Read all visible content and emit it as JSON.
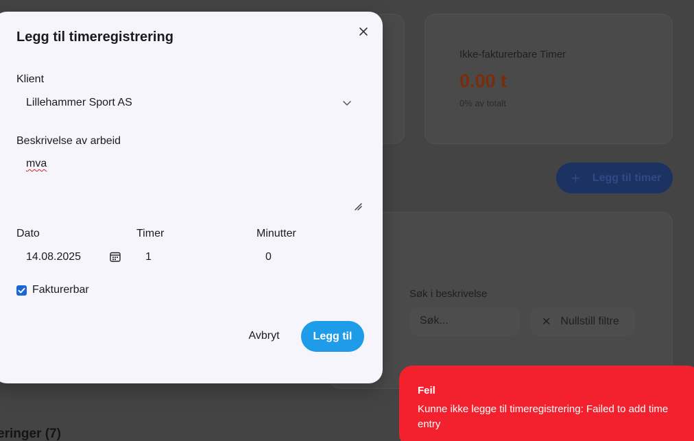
{
  "background": {
    "stats": {
      "label": "Ikke-fakturerbare Timer",
      "value": "0.00 t",
      "sub": "0% av totalt"
    },
    "add_button_label": "Legg til timer",
    "filters": {
      "search_label": "Søk i beskrivelse",
      "search_placeholder": "Søk...",
      "reset_label": "Nullstill filtre"
    },
    "section_title": "eringer (7)"
  },
  "modal": {
    "title": "Legg til timeregistrering",
    "client_label": "Klient",
    "client_value": "Lillehammer Sport AS",
    "description_label": "Beskrivelse av arbeid",
    "description_value": "mva",
    "date_label": "Dato",
    "date_value": "14.08.2025",
    "hours_label": "Timer",
    "hours_value": "1",
    "minutes_label": "Minutter",
    "minutes_value": "0",
    "billable_label": "Fakturerbar",
    "billable_checked": true,
    "cancel_label": "Avbryt",
    "submit_label": "Legg til"
  },
  "toast": {
    "title": "Feil",
    "message": "Kunne ikke legge til timeregistrering: Failed to add time entry"
  },
  "colors": {
    "accent": "#1e9be9",
    "error": "#f3212e",
    "checkbox": "#1a66d6"
  }
}
